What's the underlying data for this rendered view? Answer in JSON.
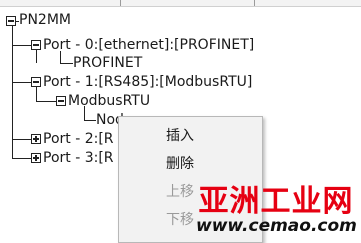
{
  "tree": {
    "root": {
      "label": "PN2MM",
      "expanded": true
    },
    "port0": {
      "label": "Port - 0:[ethernet]:[PROFINET]",
      "expanded": true
    },
    "port0_child": {
      "label": "PROFINET"
    },
    "port1": {
      "label": "Port - 1:[RS485]:[ModbusRTU]",
      "expanded": true
    },
    "port1_child": {
      "label": "ModbusRTU",
      "expanded": true
    },
    "port1_grandchild": {
      "label": "Nod"
    },
    "port2": {
      "label": "Port - 2:[R",
      "expanded": false
    },
    "port3": {
      "label": "Port - 3:[R",
      "expanded": false
    }
  },
  "context_menu": {
    "items": [
      {
        "label": "插入",
        "enabled": true
      },
      {
        "label": "删除",
        "enabled": true
      },
      {
        "label": "上移",
        "enabled": false
      },
      {
        "label": "下移",
        "enabled": false
      }
    ]
  },
  "watermark": {
    "title": "亚洲工业网",
    "url": "www.cemao.com"
  },
  "colors": {
    "watermark_red": "#e60012",
    "menu_background": "#f2f2f2",
    "disabled_text": "#9a9a9a"
  }
}
